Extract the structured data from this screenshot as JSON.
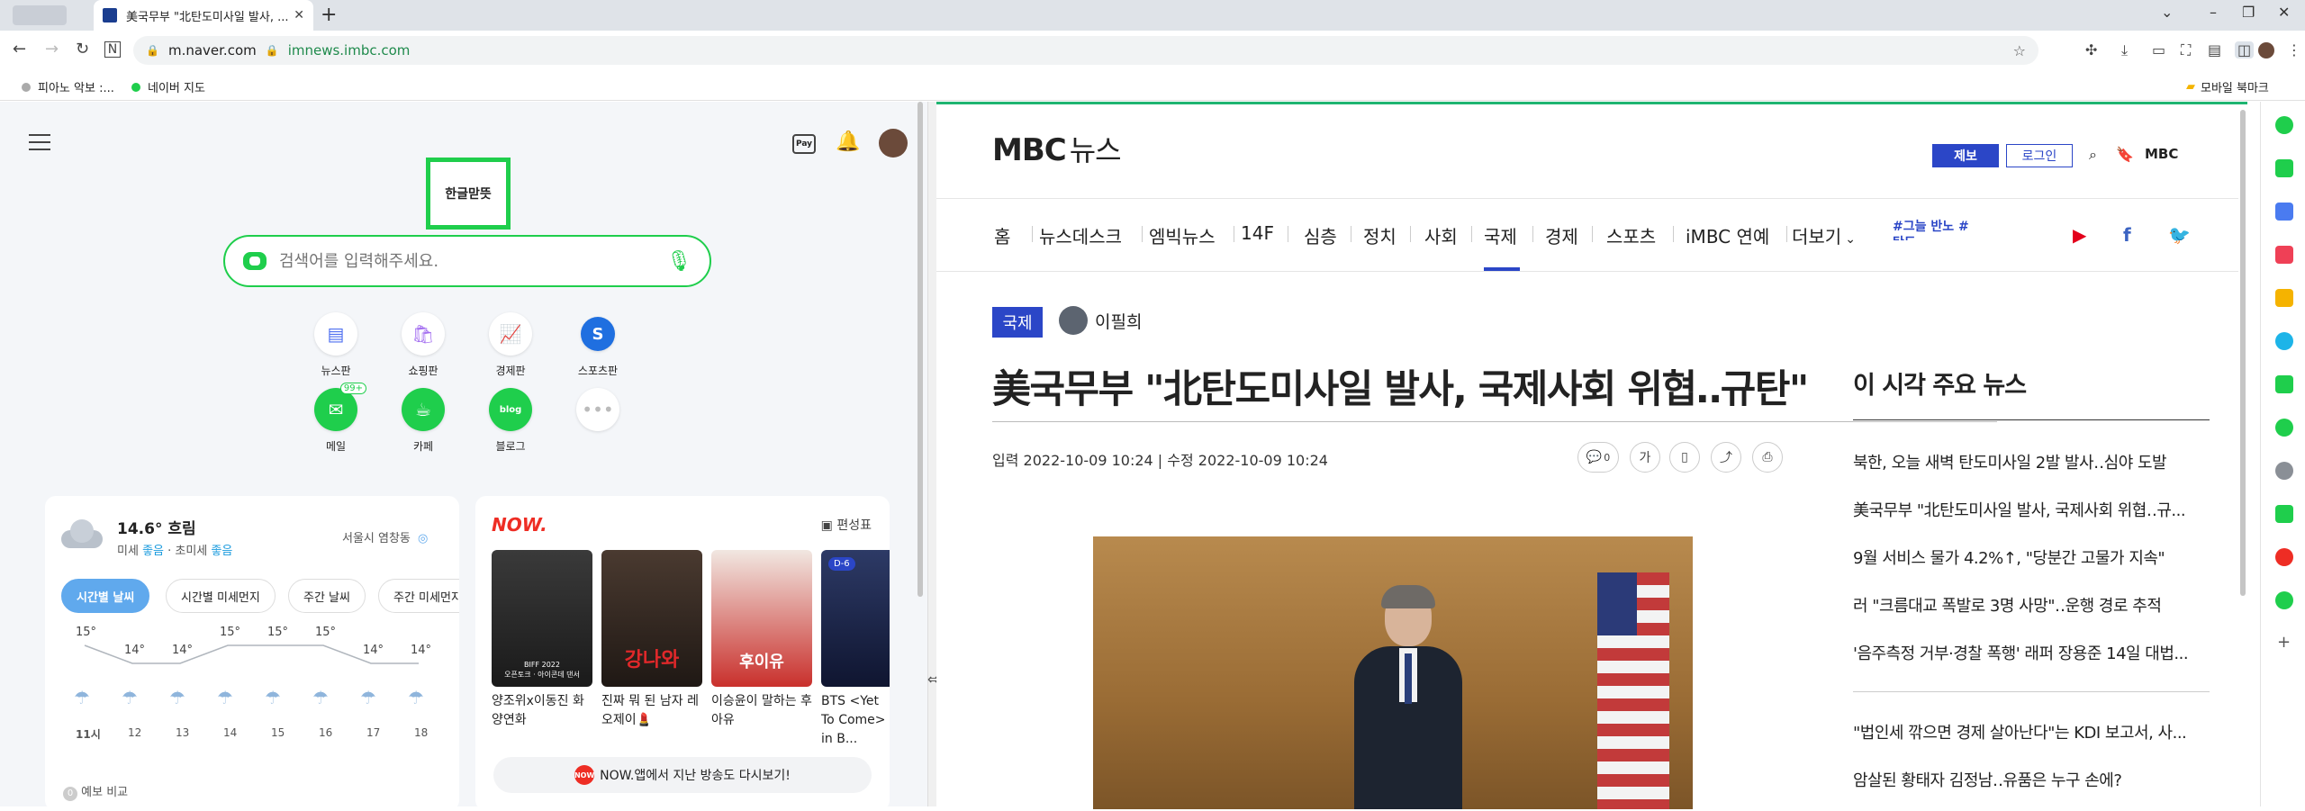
{
  "browser": {
    "tab_title": "美국무부 \"北탄도미사일 발사, ...",
    "address_domain": "m.naver.com",
    "address_url": "imnews.imbc.com",
    "bookmarks": [
      "피아노 악보 :...",
      "네이버 지도"
    ],
    "mobile_bookmarks": "모바일 북마크",
    "icons": [
      "back-icon",
      "forward-icon",
      "reload-icon",
      "naver-home-icon",
      "lock-icon"
    ]
  },
  "naver": {
    "doodle_text": "한글맏뜻",
    "search_placeholder": "검색어를 입력해주세요.",
    "shortcuts": [
      {
        "label": "뉴스판",
        "icon": "news-icon",
        "color": "#4e6ff0"
      },
      {
        "label": "쇼핑판",
        "icon": "shopping-icon",
        "color": "#a26cf0"
      },
      {
        "label": "경제판",
        "icon": "economy-icon",
        "color": "#3a64e0"
      },
      {
        "label": "스포츠판",
        "icon": "sports-icon",
        "color": "#1f6fe0"
      },
      {
        "label": "메일",
        "icon": "mail-icon",
        "color": "#1fce4c",
        "badge": "99+"
      },
      {
        "label": "카페",
        "icon": "cafe-icon",
        "color": "#1fce4c"
      },
      {
        "label": "블로그",
        "icon": "blog-icon",
        "color": "#1fce4c",
        "mark": "blog"
      },
      {
        "label": "",
        "icon": "more-icon",
        "color": "#cccccc"
      }
    ],
    "weather": {
      "temp": "14.6° 흐림",
      "dust_prefix": "미세",
      "dust_value": "좋음",
      "fine_dust_prefix": "· 초미세",
      "fine_dust_value": "좋음",
      "location": "서울시 염창동",
      "tabs": [
        "시간별 날씨",
        "시간별 미세먼지",
        "주간 날씨",
        "주간 미세먼지"
      ],
      "hourly": [
        {
          "hour": "11시",
          "temp": "15°"
        },
        {
          "hour": "12",
          "temp": "14°"
        },
        {
          "hour": "13",
          "temp": "14°"
        },
        {
          "hour": "14",
          "temp": "15°"
        },
        {
          "hour": "15",
          "temp": "15°"
        },
        {
          "hour": "16",
          "temp": "15°"
        },
        {
          "hour": "17",
          "temp": "14°"
        },
        {
          "hour": "18",
          "temp": "14°"
        }
      ],
      "forecast_compare": "예보 비교"
    },
    "now": {
      "logo": "NOW.",
      "schedule": "편성표",
      "thumb_texts": [
        "BIFF 2022\n오픈토크 · 아이콘데 댄서",
        "강나와",
        "후이유",
        "D-6"
      ],
      "items": [
        {
          "caption": "양조위x이동진 화양연화",
          "color": "#2c2c2c"
        },
        {
          "caption": "진짜 뭐 된 남자 레오제이💄",
          "color": "#3a2d25"
        },
        {
          "caption": "이승윤이 말하는 후아유",
          "color": "#c9302c"
        },
        {
          "caption": "BTS <Yet To Come> in B...",
          "color": "#1a2340"
        }
      ],
      "cta": "NOW.앱에서 지난 방송도 다시보기!"
    }
  },
  "mbc": {
    "logo_brand": "MBC",
    "logo_suffix": "뉴스",
    "tip_label": "제보",
    "login_label": "로그인",
    "header_mbc": "MBC",
    "menu": [
      "홈",
      "뉴스데스크",
      "엠빅뉴스",
      "14F",
      "심층",
      "정치",
      "사회",
      "국제",
      "경제",
      "스포츠",
      "iMBC 연예",
      "더보기"
    ],
    "active_menu": "국제",
    "tag_text": "#그늘 반노 #탄도",
    "category": "국제",
    "reporter": "이필희",
    "headline": "美국무부 \"北탄도미사일 발사, 국제사회 위협‥규탄\"",
    "dateline": "입력 2022-10-09 10:24 | 수정 2022-10-09 10:24",
    "comment_count": "0",
    "font_size_label": "가",
    "side": {
      "title": "이 시각 주요 뉴스",
      "group1": [
        "북한, 오늘 새벽 탄도미사일 2발 발사‥심야 도발",
        "美국무부 \"北탄도미사일 발사, 국제사회 위협‥규...",
        "9월 서비스 물가 4.2%↑, \"당분간 고물가 지속\"",
        "러 \"크름대교 폭발로 3명 사망\"‥운행 경로 추적",
        "'음주측정 거부·경찰 폭행' 래퍼 장용준 14일 대법..."
      ],
      "group2": [
        "\"법인세 깎으면 경제 살아난다\"는 KDI 보고서, 사...",
        "암살된 황태자 김정남‥유품은 누구 손에?"
      ]
    }
  }
}
